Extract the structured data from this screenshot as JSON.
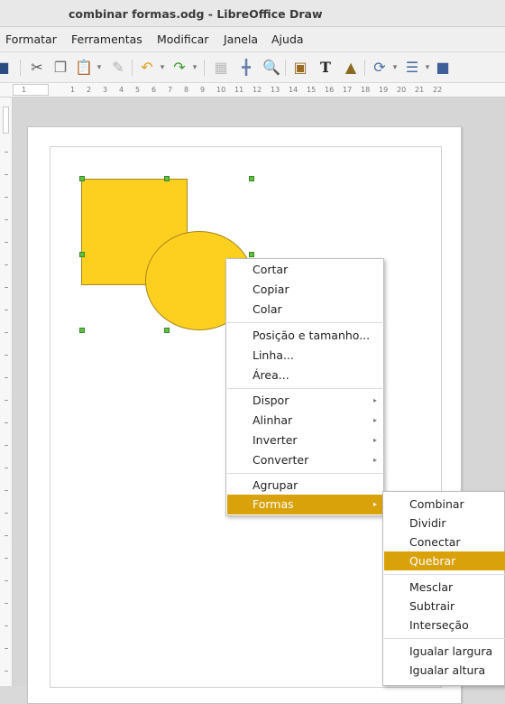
{
  "window": {
    "title": "combinar formas.odg - LibreOffice Draw"
  },
  "menubar": {
    "items": [
      "Formatar",
      "Ferramentas",
      "Modificar",
      "Janela",
      "Ajuda"
    ]
  },
  "toolbar": {
    "icons": [
      "save-icon",
      "cut-icon",
      "copy-icon",
      "paste-icon",
      "clone-formatting-icon",
      "undo-icon",
      "redo-icon",
      "grid-icon",
      "helplines-icon",
      "zoom-icon",
      "image-icon",
      "textbox-icon",
      "fontwork-icon",
      "rotate-icon",
      "align-icon",
      "arrange-icon"
    ]
  },
  "ruler": {
    "ticks": [
      "1",
      "1",
      "2",
      "3",
      "4",
      "5",
      "6",
      "7",
      "8",
      "9",
      "10",
      "11",
      "12",
      "13",
      "14",
      "15",
      "16",
      "17",
      "18",
      "19",
      "20",
      "21",
      "22"
    ]
  },
  "canvas": {
    "shape_color": "#fdd020",
    "handle_color": "#60c040"
  },
  "context_menu": {
    "items": [
      {
        "label": "Cortar"
      },
      {
        "label": "Copiar"
      },
      {
        "label": "Colar"
      },
      {
        "label": "Posição e tamanho..."
      },
      {
        "label": "Linha..."
      },
      {
        "label": "Área..."
      },
      {
        "label": "Dispor",
        "submenu": true
      },
      {
        "label": "Alinhar",
        "submenu": true
      },
      {
        "label": "Inverter",
        "submenu": true
      },
      {
        "label": "Converter",
        "submenu": true
      },
      {
        "label": "Agrupar"
      },
      {
        "label": "Formas",
        "submenu": true,
        "selected": true
      }
    ]
  },
  "submenu": {
    "items": [
      {
        "label": "Combinar"
      },
      {
        "label": "Dividir"
      },
      {
        "label": "Conectar"
      },
      {
        "label": "Quebrar",
        "selected": true
      },
      {
        "label": "Mesclar"
      },
      {
        "label": "Subtrair"
      },
      {
        "label": "Interseção"
      },
      {
        "label": "Igualar largura"
      },
      {
        "label": "Igualar altura"
      }
    ]
  },
  "colors": {
    "highlight": "#d9a10a"
  }
}
